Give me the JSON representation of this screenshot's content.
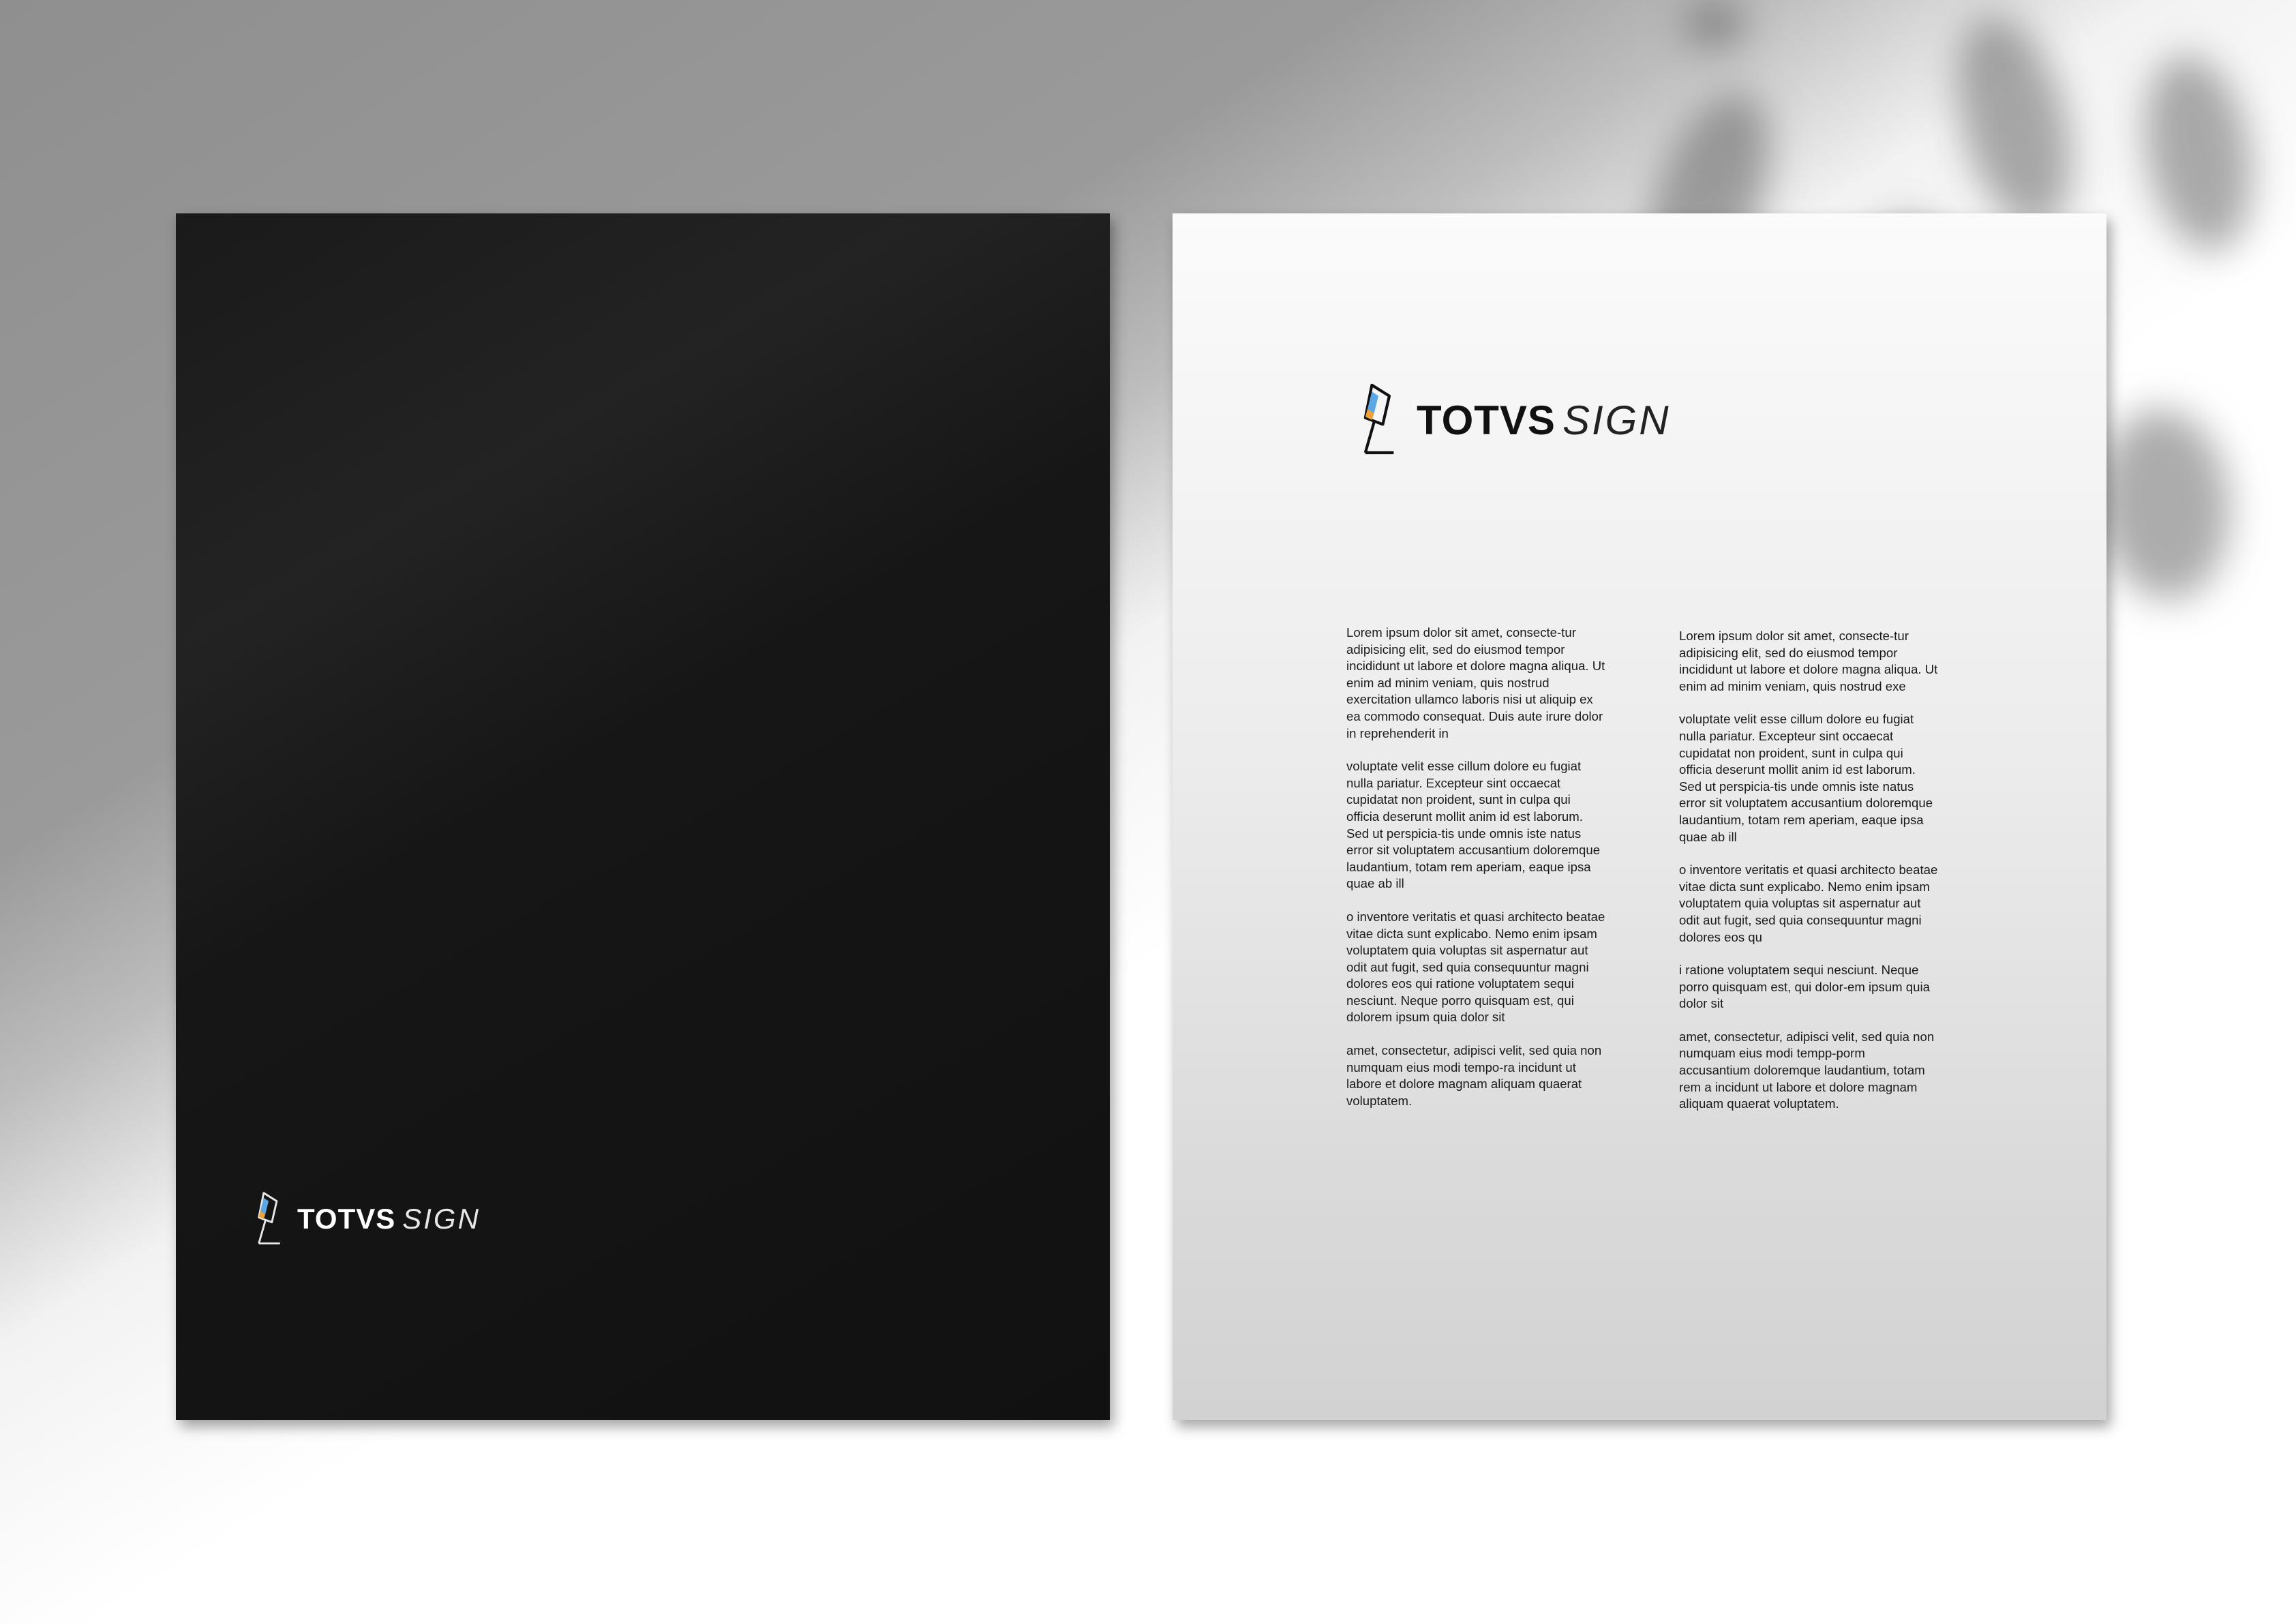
{
  "brand": {
    "name_strong": "TOTVS",
    "name_light": "SIGN"
  },
  "letterhead": {
    "column_1": [
      "Lorem ipsum dolor sit amet, consecte-tur adipisicing elit, sed do eiusmod tempor incididunt ut labore et dolore magna aliqua. Ut enim ad minim veniam, quis nostrud exercitation ullamco laboris nisi ut aliquip ex ea commodo consequat. Duis aute irure dolor in reprehenderit in",
      "voluptate velit esse cillum dolore eu fugiat nulla pariatur. Excepteur sint occaecat cupidatat non proident, sunt in culpa qui officia deserunt mollit anim id est laborum. Sed ut perspicia-tis unde omnis iste natus error sit voluptatem accusantium doloremque laudantium, totam rem aperiam, eaque ipsa quae ab ill",
      "o inventore veritatis et quasi architecto beatae vitae dicta sunt explicabo. Nemo enim ipsam voluptatem quia voluptas sit aspernatur aut odit aut fugit, sed quia consequuntur magni dolores eos qui ratione voluptatem sequi nesciunt. Neque porro quisquam est, qui dolorem ipsum quia dolor sit",
      "amet, consectetur, adipisci velit, sed quia non numquam eius modi tempo-ra incidunt ut labore et dolore magnam aliquam quaerat voluptatem."
    ],
    "column_2": [
      "Lorem ipsum dolor sit amet, consecte-tur adipisicing elit, sed do eiusmod tempor incididunt ut labore et dolore magna aliqua. Ut enim ad minim veniam, quis nostrud exe",
      "voluptate velit esse cillum dolore eu fugiat nulla pariatur. Excepteur sint occaecat cupidatat non proident, sunt in culpa qui officia deserunt mollit anim id est laborum. Sed ut perspicia-tis unde omnis iste natus error sit voluptatem accusantium doloremque laudantium, totam rem aperiam, eaque ipsa quae ab ill",
      "o inventore veritatis et quasi architecto beatae vitae dicta sunt explicabo. Nemo enim ipsam voluptatem quia voluptas sit aspernatur aut odit aut fugit, sed quia consequuntur magni dolores eos qu",
      "i ratione voluptatem sequi nesciunt. Neque porro quisquam est, qui dolor-em ipsum quia dolor sit",
      "amet, consectetur, adipisci velit, sed quia non numquam eius modi tempp-porm accusantium doloremque laudantium, totam rem a incidunt ut labore et dolore magnam aliquam quaerat voluptatem."
    ]
  },
  "icons": {
    "logo_mark": "pen-nib-logo-icon"
  },
  "colors": {
    "dark_sheet": "#141414",
    "light_sheet": "#e9e9e9",
    "logo_accent_blue": "#5aa9e6",
    "logo_accent_orange": "#f0a23a"
  }
}
